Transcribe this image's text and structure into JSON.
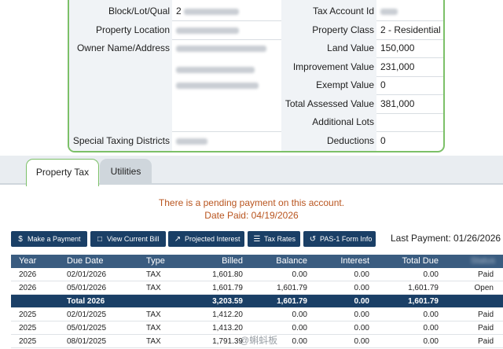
{
  "property": {
    "left": [
      {
        "label": "Block/Lot/Qual",
        "value": "2"
      },
      {
        "label": "Property Location",
        "value": ""
      },
      {
        "label": "Owner Name/Address",
        "value": ""
      },
      {
        "label": "Special Taxing Districts",
        "value": ""
      }
    ],
    "right": [
      {
        "label": "Tax Account Id",
        "value": ""
      },
      {
        "label": "Property Class",
        "value": "2 - Residential"
      },
      {
        "label": "Land Value",
        "value": "150,000"
      },
      {
        "label": "Improvement Value",
        "value": "231,000"
      },
      {
        "label": "Exempt Value",
        "value": "0"
      },
      {
        "label": "Total Assessed Value",
        "value": "381,000"
      },
      {
        "label": "Additional Lots",
        "value": ""
      },
      {
        "label": "Deductions",
        "value": "0"
      }
    ]
  },
  "tabs": [
    {
      "label": "Property Tax",
      "active": true
    },
    {
      "label": "Utilities",
      "active": false
    }
  ],
  "notice": {
    "line1": "There is a pending payment on this account.",
    "line2": "Date Paid: 04/19/2026"
  },
  "actions": [
    {
      "label": "Make a Payment",
      "icon": "dollar-icon"
    },
    {
      "label": "View Current Bill",
      "icon": "document-icon"
    },
    {
      "label": "Projected Interest",
      "icon": "chart-icon"
    },
    {
      "label": "Tax Rates",
      "icon": "list-icon"
    },
    {
      "label": "PAS-1 Form Info",
      "icon": "history-icon"
    }
  ],
  "last_payment": "Last Payment: 01/26/2026",
  "table": {
    "headers": [
      "Year",
      "Due Date",
      "Type",
      "Billed",
      "Balance",
      "Interest",
      "Total Due",
      "Status"
    ],
    "rows": [
      {
        "year": "2026",
        "due": "02/01/2026",
        "type": "TAX",
        "billed": "1,601.80",
        "balance": "0.00",
        "interest": "0.00",
        "total": "0.00",
        "status": "Paid"
      },
      {
        "year": "2026",
        "due": "05/01/2026",
        "type": "TAX",
        "billed": "1,601.79",
        "balance": "1,601.79",
        "interest": "0.00",
        "total": "1,601.79",
        "status": "Open"
      },
      {
        "total": true,
        "label": "Total 2026",
        "billed": "3,203.59",
        "balance": "1,601.79",
        "interest": "0.00",
        "totaldue": "1,601.79"
      },
      {
        "year": "2025",
        "due": "02/01/2025",
        "type": "TAX",
        "billed": "1,412.20",
        "balance": "0.00",
        "interest": "0.00",
        "total": "0.00",
        "status": "Paid"
      },
      {
        "year": "2025",
        "due": "05/01/2025",
        "type": "TAX",
        "billed": "1,413.20",
        "balance": "0.00",
        "interest": "0.00",
        "total": "0.00",
        "status": "Paid"
      },
      {
        "year": "2025",
        "due": "08/01/2025",
        "type": "TAX",
        "billed": "1,791.39",
        "balance": "0.00",
        "interest": "0.00",
        "total": "0.00",
        "status": "Paid"
      }
    ]
  },
  "watermark": "@蝌蚪板"
}
